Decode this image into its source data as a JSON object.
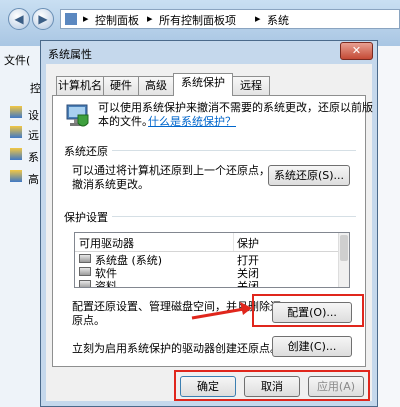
{
  "breadcrumb": {
    "sep": "▸",
    "items": [
      "控制面板",
      "所有控制面板项",
      "系统"
    ]
  },
  "background": {
    "left_items": [
      "文件(",
      "控",
      "设",
      "远",
      "系",
      "高"
    ]
  },
  "dialog": {
    "title": "系统属性",
    "close": "✕",
    "tabs": [
      "计算机名",
      "硬件",
      "高级",
      "系统保护",
      "远程"
    ],
    "intro_line1": "可以使用系统保护来撤消不需要的系统更改，还原以前版",
    "intro_line2": "本的文件。",
    "intro_link": "什么是系统保护？",
    "restore_group": "系统还原",
    "restore_text_line1": "可以通过将计算机还原到上一个还原点，",
    "restore_text_line2": "撤消系统更改。",
    "restore_button": "系统还原(S)...",
    "protect_group": "保护设置",
    "table_headers": [
      "可用驱动器",
      "保护"
    ],
    "drives": [
      {
        "name": "系统盘 (系统)",
        "status": "打开"
      },
      {
        "name": "软件",
        "status": "关闭"
      },
      {
        "name": "资料",
        "status": "关闭"
      }
    ],
    "config_text_line1": "配置还原设置、管理磁盘空间，并且删除还",
    "config_text_line2": "原点。",
    "config_button": "配置(O)...",
    "create_text": "立刻为启用系统保护的驱动器创建还原点。",
    "create_button": "创建(C)...",
    "ok_button": "确定",
    "cancel_button": "取消",
    "apply_button": "应用(A)"
  },
  "colors": {
    "annotation": "#e0261c",
    "link": "#0066cc"
  }
}
